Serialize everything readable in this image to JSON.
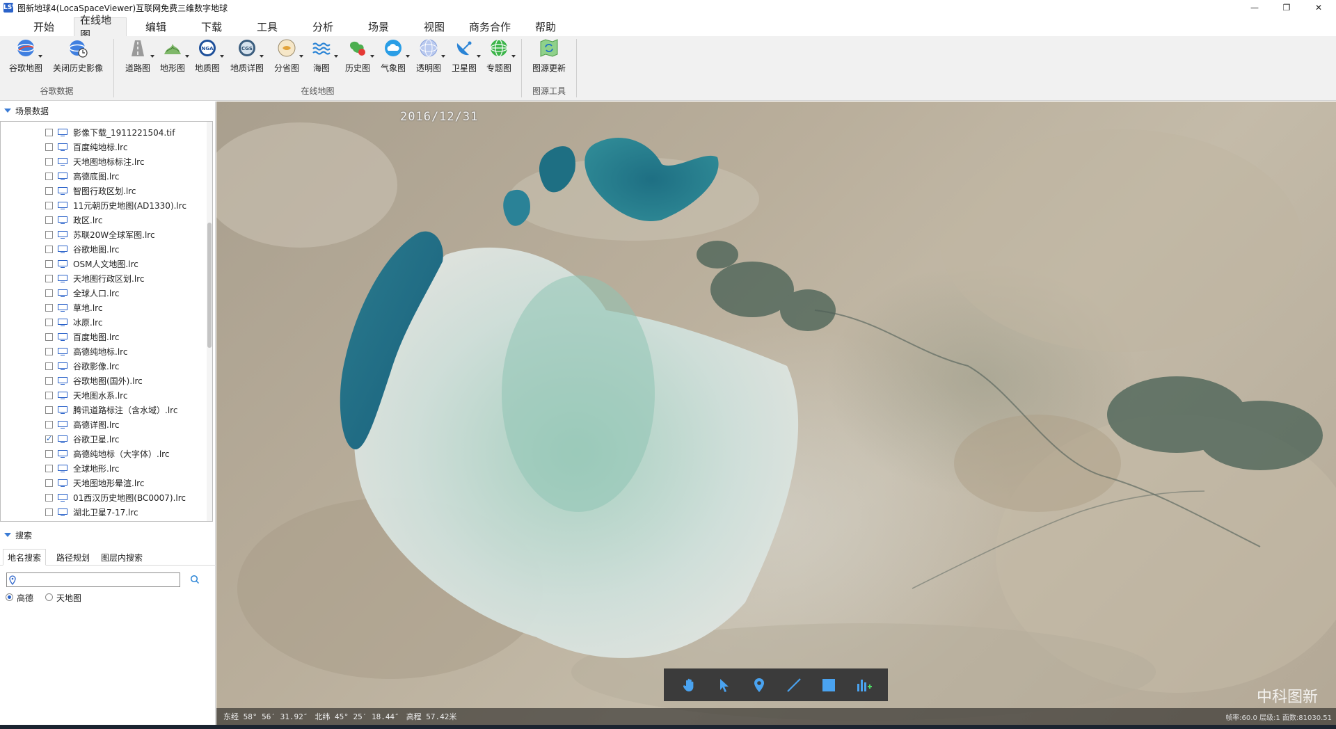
{
  "window": {
    "title": "图新地球4(LocaSpaceViewer)互联网免费三维数字地球",
    "icon_text": "LSV",
    "controls": {
      "minimize": "—",
      "restore": "❐",
      "close": "✕"
    }
  },
  "menu": {
    "tabs": [
      "开始",
      "在线地图",
      "编辑",
      "下载",
      "工具",
      "分析",
      "场景",
      "视图",
      "商务合作",
      "帮助"
    ],
    "active": "在线地图"
  },
  "ribbon": {
    "groups": [
      {
        "label": "谷歌数据",
        "buttons": [
          {
            "label": "谷歌地图",
            "icon": "google-globe-icon",
            "dropdown": true
          },
          {
            "label": "关闭历史影像",
            "icon": "history-clock-globe-icon",
            "dropdown": false
          }
        ]
      },
      {
        "label": "在线地图",
        "buttons": [
          {
            "label": "道路图",
            "icon": "road-icon",
            "dropdown": true
          },
          {
            "label": "地形图",
            "icon": "terrain-icon",
            "dropdown": true
          },
          {
            "label": "地质图",
            "icon": "nga-icon",
            "icon_text": "NGA",
            "dropdown": true
          },
          {
            "label": "地质详图",
            "icon": "cgs-icon",
            "icon_text": "CGS",
            "dropdown": true
          },
          {
            "label": "分省图",
            "icon": "province-map-icon",
            "dropdown": true
          },
          {
            "label": "海图",
            "icon": "sea-waves-icon",
            "dropdown": true
          },
          {
            "label": "历史图",
            "icon": "history-map-icon",
            "dropdown": true
          },
          {
            "label": "气象图",
            "icon": "weather-cloud-icon",
            "dropdown": true
          },
          {
            "label": "透明图",
            "icon": "transparent-globe-icon",
            "dropdown": true
          },
          {
            "label": "卫星图",
            "icon": "satellite-dish-icon",
            "dropdown": true
          },
          {
            "label": "专题图",
            "icon": "thematic-globe-icon",
            "dropdown": true
          }
        ]
      },
      {
        "label": "图源工具",
        "buttons": [
          {
            "label": "图源更新",
            "icon": "map-refresh-icon",
            "dropdown": false
          }
        ]
      }
    ]
  },
  "scene_panel": {
    "title": "场景数据",
    "layers": [
      {
        "name": "影像下载_1911221504.tif",
        "checked": false
      },
      {
        "name": "百度纯地标.lrc",
        "checked": false
      },
      {
        "name": "天地图地标标注.lrc",
        "checked": false
      },
      {
        "name": "高德底图.lrc",
        "checked": false
      },
      {
        "name": "智图行政区划.lrc",
        "checked": false
      },
      {
        "name": "11元朝历史地图(AD1330).lrc",
        "checked": false
      },
      {
        "name": "政区.lrc",
        "checked": false
      },
      {
        "name": "苏联20W全球军图.lrc",
        "checked": false
      },
      {
        "name": "谷歌地图.lrc",
        "checked": false
      },
      {
        "name": "OSM人文地图.lrc",
        "checked": false
      },
      {
        "name": "天地图行政区划.lrc",
        "checked": false
      },
      {
        "name": "全球人口.lrc",
        "checked": false
      },
      {
        "name": "草地.lrc",
        "checked": false
      },
      {
        "name": "冰原.lrc",
        "checked": false
      },
      {
        "name": "百度地图.lrc",
        "checked": false
      },
      {
        "name": "高德纯地标.lrc",
        "checked": false
      },
      {
        "name": "谷歌影像.lrc",
        "checked": false
      },
      {
        "name": "谷歌地图(国外).lrc",
        "checked": false
      },
      {
        "name": "天地图水系.lrc",
        "checked": false
      },
      {
        "name": "腾讯道路标注（含水域）.lrc",
        "checked": false
      },
      {
        "name": "高德详图.lrc",
        "checked": false
      },
      {
        "name": "谷歌卫星.lrc",
        "checked": true
      },
      {
        "name": "高德纯地标（大字体）.lrc",
        "checked": false
      },
      {
        "name": "全球地形.lrc",
        "checked": false
      },
      {
        "name": "天地图地形晕渲.lrc",
        "checked": false
      },
      {
        "name": "01西汉历史地图(BC0007).lrc",
        "checked": false
      },
      {
        "name": "湖北卫星7-17.lrc",
        "checked": false
      }
    ]
  },
  "search_panel": {
    "title": "搜索",
    "tabs": [
      "地名搜索",
      "路径规划",
      "图层内搜索"
    ],
    "active_tab": "地名搜索",
    "input_value": "",
    "input_placeholder": "",
    "sources": [
      {
        "label": "高德",
        "selected": true
      },
      {
        "label": "天地图",
        "selected": false
      }
    ]
  },
  "map": {
    "date": "2016/12/31",
    "watermark": "中科图新",
    "status": {
      "longitude": "东经 58° 56′ 31.92″",
      "latitude": "北纬 45° 25′ 18.44″",
      "elevation": "高程 57.42米",
      "right": "帧率:60.0  层级:1  面数:81030.51"
    },
    "toolbar": [
      "pan-hand-icon",
      "select-arrow-icon",
      "place-marker-icon",
      "draw-line-icon",
      "draw-rectangle-icon",
      "add-chart-icon"
    ]
  },
  "colors": {
    "accent": "#2a62c9",
    "map_toolbar_bg": "#3b3b3b",
    "ribbon_bg": "#f1f1f1",
    "water_deep": "#1f6f8a",
    "water_shallow": "#7fb8ad"
  }
}
